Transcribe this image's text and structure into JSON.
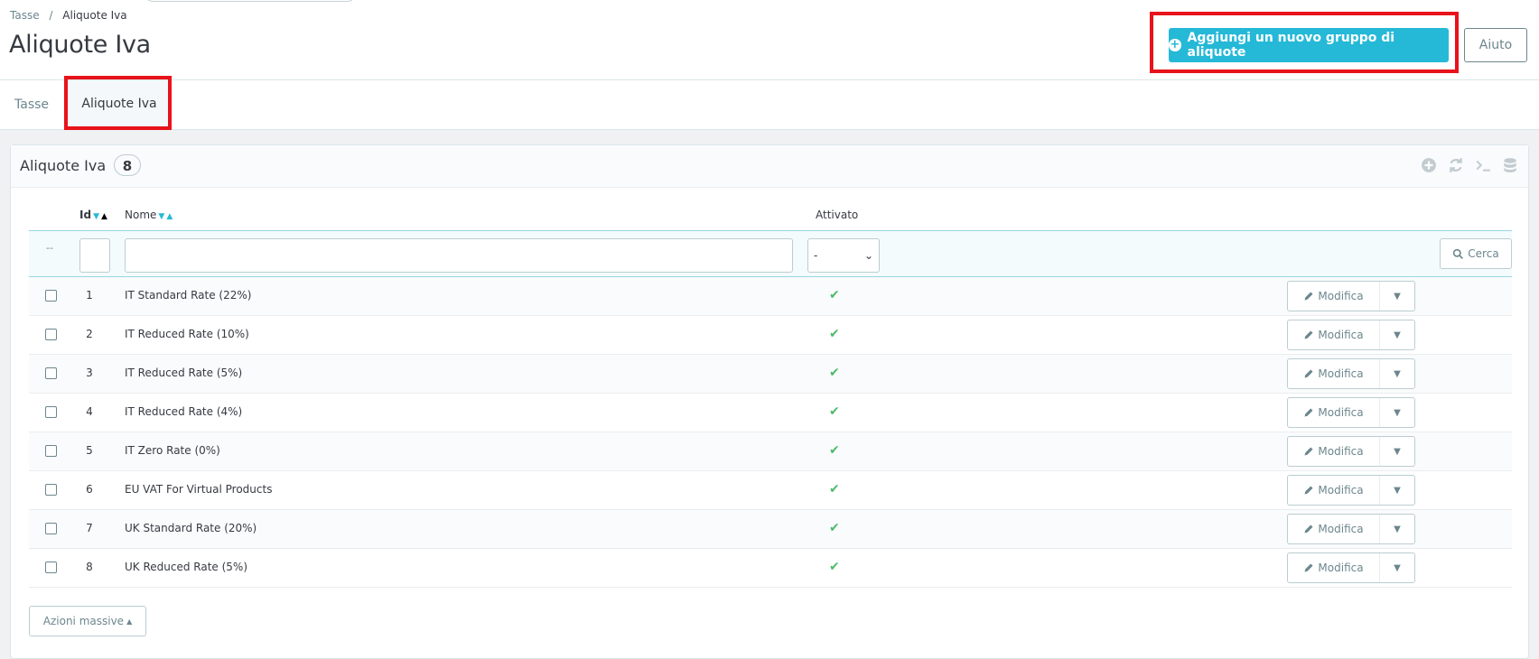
{
  "breadcrumb": {
    "parent": "Tasse",
    "separator": "/",
    "current": "Aliquote Iva"
  },
  "page": {
    "title": "Aliquote Iva"
  },
  "toolbar": {
    "add_label": "Aggiungi un nuovo gruppo di aliquote",
    "help_label": "Aiuto"
  },
  "tabs": [
    {
      "label": "Tasse"
    },
    {
      "label": "Aliquote Iva"
    }
  ],
  "panel": {
    "title": "Aliquote Iva",
    "count": "8",
    "tool_icons": [
      "add-icon",
      "refresh-icon",
      "sql-icon",
      "database-icon"
    ]
  },
  "table": {
    "headers": {
      "id": "Id",
      "name": "Nome",
      "active": "Attivato"
    },
    "filter": {
      "dash": "--",
      "active_value": "-",
      "search_label": "Cerca"
    },
    "rows": [
      {
        "id": "1",
        "name": "IT Standard Rate (22%)"
      },
      {
        "id": "2",
        "name": "IT Reduced Rate (10%)"
      },
      {
        "id": "3",
        "name": "IT Reduced Rate (5%)"
      },
      {
        "id": "4",
        "name": "IT Reduced Rate (4%)"
      },
      {
        "id": "5",
        "name": "IT Zero Rate (0%)"
      },
      {
        "id": "6",
        "name": "EU VAT For Virtual Products"
      },
      {
        "id": "7",
        "name": "UK Standard Rate (20%)"
      },
      {
        "id": "8",
        "name": "UK Reduced Rate (5%)"
      }
    ],
    "edit_label": "Modifica",
    "active_mark": "✔"
  },
  "bulk": {
    "label": "Azioni massive"
  },
  "colors": {
    "accent": "#25b9d7",
    "highlight": "#e8121a",
    "success": "#4cbb6c"
  }
}
